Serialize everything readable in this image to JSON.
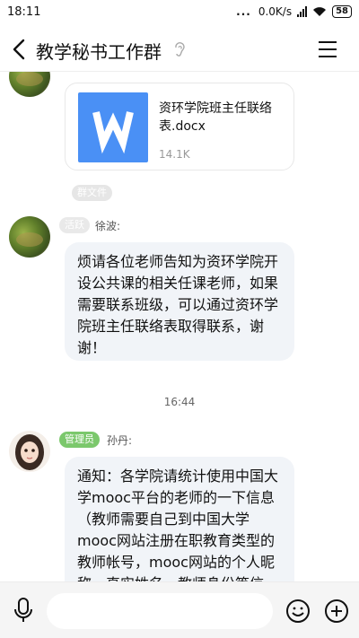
{
  "status_bar": {
    "time": "18:11",
    "network_speed": "0.0K/s",
    "battery": "58",
    "dots": "..."
  },
  "header": {
    "title": "教学秘书工作群"
  },
  "messages": {
    "file": {
      "name": "资环学院班主任联络表.docx",
      "size": "14.1K",
      "icon_letter": "W",
      "tag": "群文件"
    },
    "msg1": {
      "badge": "活跃",
      "sender": "徐波:",
      "text": "烦请各位老师告知为资环学院开设公共课的相关任课老师，如果需要联系班级，可以通过资环学院班主任联络表取得联系，谢谢！"
    },
    "timestamp": "16:44",
    "msg2": {
      "badge": "管理员",
      "sender": "孙丹:",
      "text": "通知：各学院请统计使用中国大学mooc平台的老师的一下信息（教师需要自己到中国大学mooc网站注册在职教育类型的教师帐号，mooc网站的个人昵称、真实姓名、教师身份等信息）"
    }
  },
  "input_bar": {
    "placeholder": ""
  },
  "colors": {
    "file_icon_blue": "#4a90f5",
    "admin_badge_green": "#7bc86c",
    "bubble_bg": "#f1f4f8"
  }
}
